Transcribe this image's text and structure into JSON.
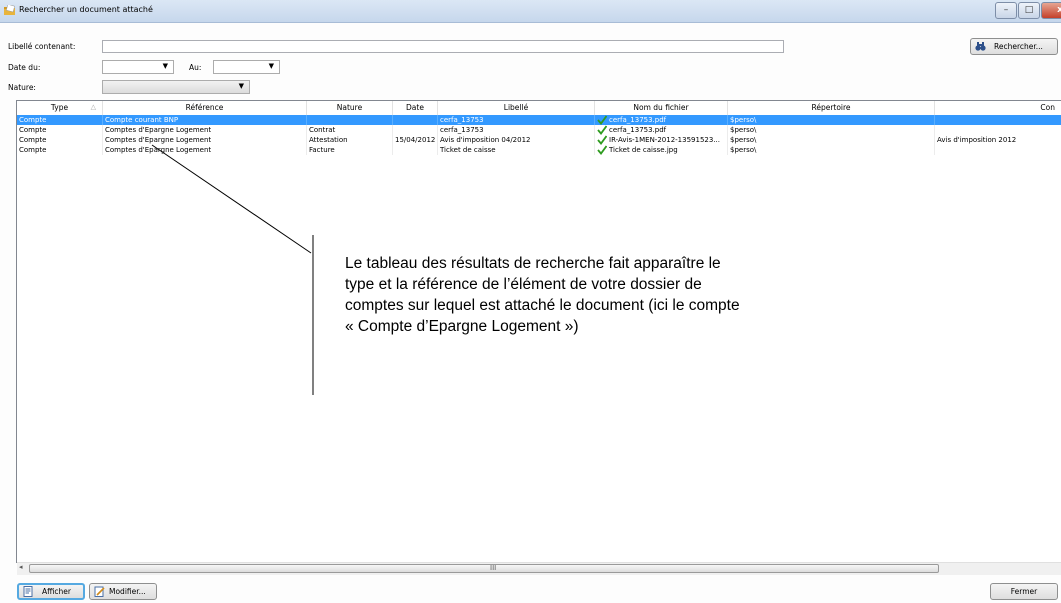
{
  "window": {
    "title": "Rechercher un document attaché"
  },
  "window_controls": {
    "minimize": "–",
    "maximize": "□",
    "close": "x"
  },
  "search": {
    "libelle_label": "Libellé contenant:",
    "libelle_value": "",
    "date_du_label": "Date du:",
    "date_du_value": "",
    "au_label": "Au:",
    "au_value": "",
    "nature_label": "Nature:",
    "nature_value": "",
    "rechercher_button": "Rechercher..."
  },
  "table": {
    "columns": [
      "Type",
      "Référence",
      "Nature",
      "Date",
      "Libellé",
      "Nom du fichier",
      "Répertoire",
      "Con"
    ],
    "rows": [
      {
        "type": "Compte",
        "reference": "Compte courant BNP",
        "nature": "",
        "date": "",
        "libelle": "cerfa_13753",
        "fichier": "cerfa_13753.pdf",
        "repertoire": "$perso\\",
        "commentaire": "",
        "selected": true
      },
      {
        "type": "Compte",
        "reference": "Comptes d'Epargne Logement",
        "nature": "Contrat",
        "date": "",
        "libelle": "cerfa_13753",
        "fichier": "cerfa_13753.pdf",
        "repertoire": "$perso\\",
        "commentaire": "",
        "selected": false
      },
      {
        "type": "Compte",
        "reference": "Comptes d'Epargne Logement",
        "nature": "Attestation",
        "date": "15/04/2012",
        "libelle": "Avis d'imposition 04/2012",
        "fichier": "IR-Avis-1MEN-2012-13591523...",
        "repertoire": "$perso\\",
        "commentaire": "Avis d'imposition 2012",
        "selected": false
      },
      {
        "type": "Compte",
        "reference": "Comptes d'Epargne Logement",
        "nature": "Facture",
        "date": "",
        "libelle": "Ticket de caisse",
        "fichier": "Ticket de caisse.jpg",
        "repertoire": "$perso\\",
        "commentaire": "",
        "selected": false
      }
    ]
  },
  "scrollbar": {
    "grip": "III"
  },
  "footer": {
    "afficher_button": "Afficher",
    "modifier_button": "Modifier...",
    "fermer_button": "Fermer"
  },
  "annotation": {
    "text": "Le tableau des résultats de recherche fait apparaître le type et la référence  de l’élément de votre dossier de comptes sur lequel est attaché le document (ici le compte « Compte d’Epargne Logement »)"
  },
  "colors": {
    "selection": "#3399ff",
    "check": "#2e9b1f"
  },
  "icons": [
    "folder-app-icon",
    "binoculars-icon",
    "document-view-icon",
    "edit-icon",
    "checkmark-icon"
  ]
}
